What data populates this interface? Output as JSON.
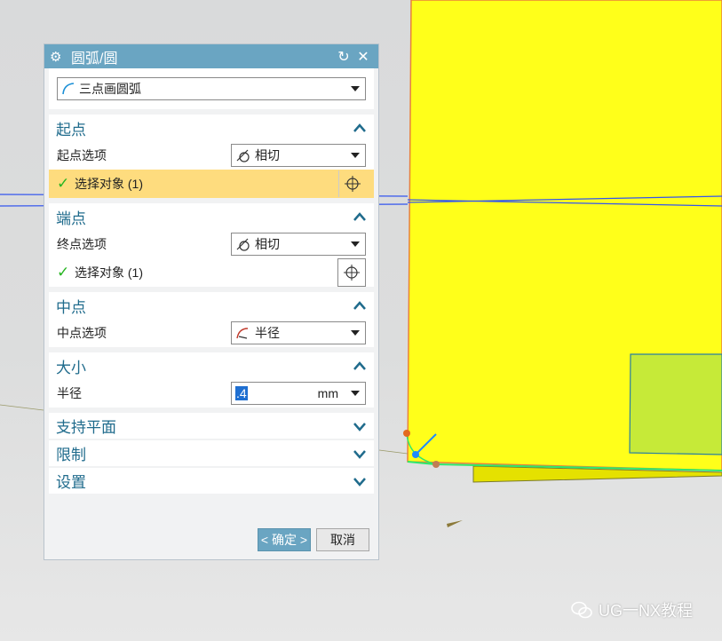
{
  "dialog": {
    "title": "圆弧/圆",
    "type_value": "三点画圆弧",
    "start": {
      "header": "起点",
      "option_label": "起点选项",
      "option_value": "相切",
      "select_text": "选择对象 (1)"
    },
    "end": {
      "header": "端点",
      "option_label": "终点选项",
      "option_value": "相切",
      "select_text": "选择对象 (1)"
    },
    "mid": {
      "header": "中点",
      "option_label": "中点选项",
      "option_value": "半径"
    },
    "size": {
      "header": "大小",
      "radius_label": "半径",
      "radius_value": ".4",
      "unit": "mm"
    },
    "collapsed_sections": [
      "支持平面",
      "限制",
      "设置"
    ],
    "ok_label": "< 确定 >",
    "cancel_label": "取消"
  },
  "watermark": "UG一NX教程",
  "colors": {
    "title_bar": "#6aa5c2",
    "section_header": "#1f6b8c",
    "active_selection": "#fedc7e",
    "model_face": "#ffff1a",
    "check": "#27b522"
  },
  "icons": [
    "gear-icon",
    "reset-icon",
    "close-icon",
    "arc-icon",
    "tangent-icon",
    "radius-icon",
    "crosshair-icon",
    "check-icon",
    "chevron-up-icon",
    "chevron-down-icon",
    "wechat-icon"
  ]
}
